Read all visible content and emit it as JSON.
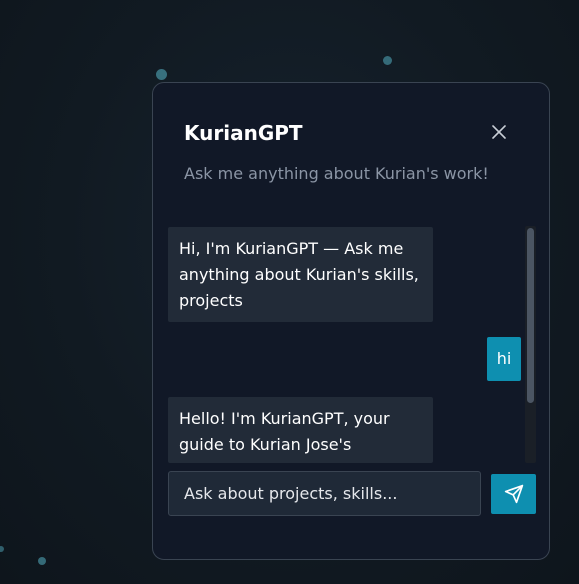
{
  "chat": {
    "title": "KurianGPT",
    "subtitle": "Ask me anything about Kurian's work!",
    "close_icon": "close-icon",
    "messages": [
      {
        "role": "bot",
        "text": "Hi, I'm KurianGPT — Ask me anything about Kurian's skills, projects"
      },
      {
        "role": "user",
        "text": "hi"
      },
      {
        "role": "bot",
        "text": "Hello! I'm KurianGPT, your guide to Kurian Jose's"
      }
    ],
    "input": {
      "value": "",
      "placeholder": "Ask about projects, skills..."
    },
    "send_icon": "send-icon",
    "colors": {
      "accent": "#0e8fb0",
      "panel_bg": "#111827",
      "bot_bubble": "#222b38"
    }
  }
}
